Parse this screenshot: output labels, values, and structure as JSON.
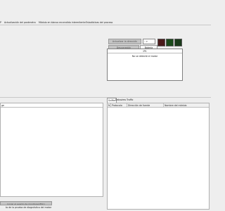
{
  "tabs": [
    "P",
    "Actualización del parámetro",
    "Módulo en blanco encendido intermitente",
    "Estadísticas del proceso"
  ],
  "controls": {
    "update_button": "Actualizar la dirección",
    "select_value": "-- ▾",
    "disconnect_button": "Desconexión",
    "battery_label": "Batería",
    "swatch_colors": [
      "#4a1a1a",
      "#1a4a1a",
      "#1a3a1a"
    ]
  },
  "detection": {
    "tab_label": "IPS",
    "header": "",
    "message": "No se detectó el motor"
  },
  "left_panel": {
    "header": "ge",
    "button_label": "Iniciar el evento de monitoreo(ESC)",
    "footer": "to de la prueba de diagnóstico del motor"
  },
  "right_panel": {
    "tabs": [
      "Sniffer",
      "Dataview Traffic"
    ],
    "columns": [
      "N",
      "Protocolo",
      "Dirección de fuente",
      "Nombre del módulo"
    ]
  }
}
